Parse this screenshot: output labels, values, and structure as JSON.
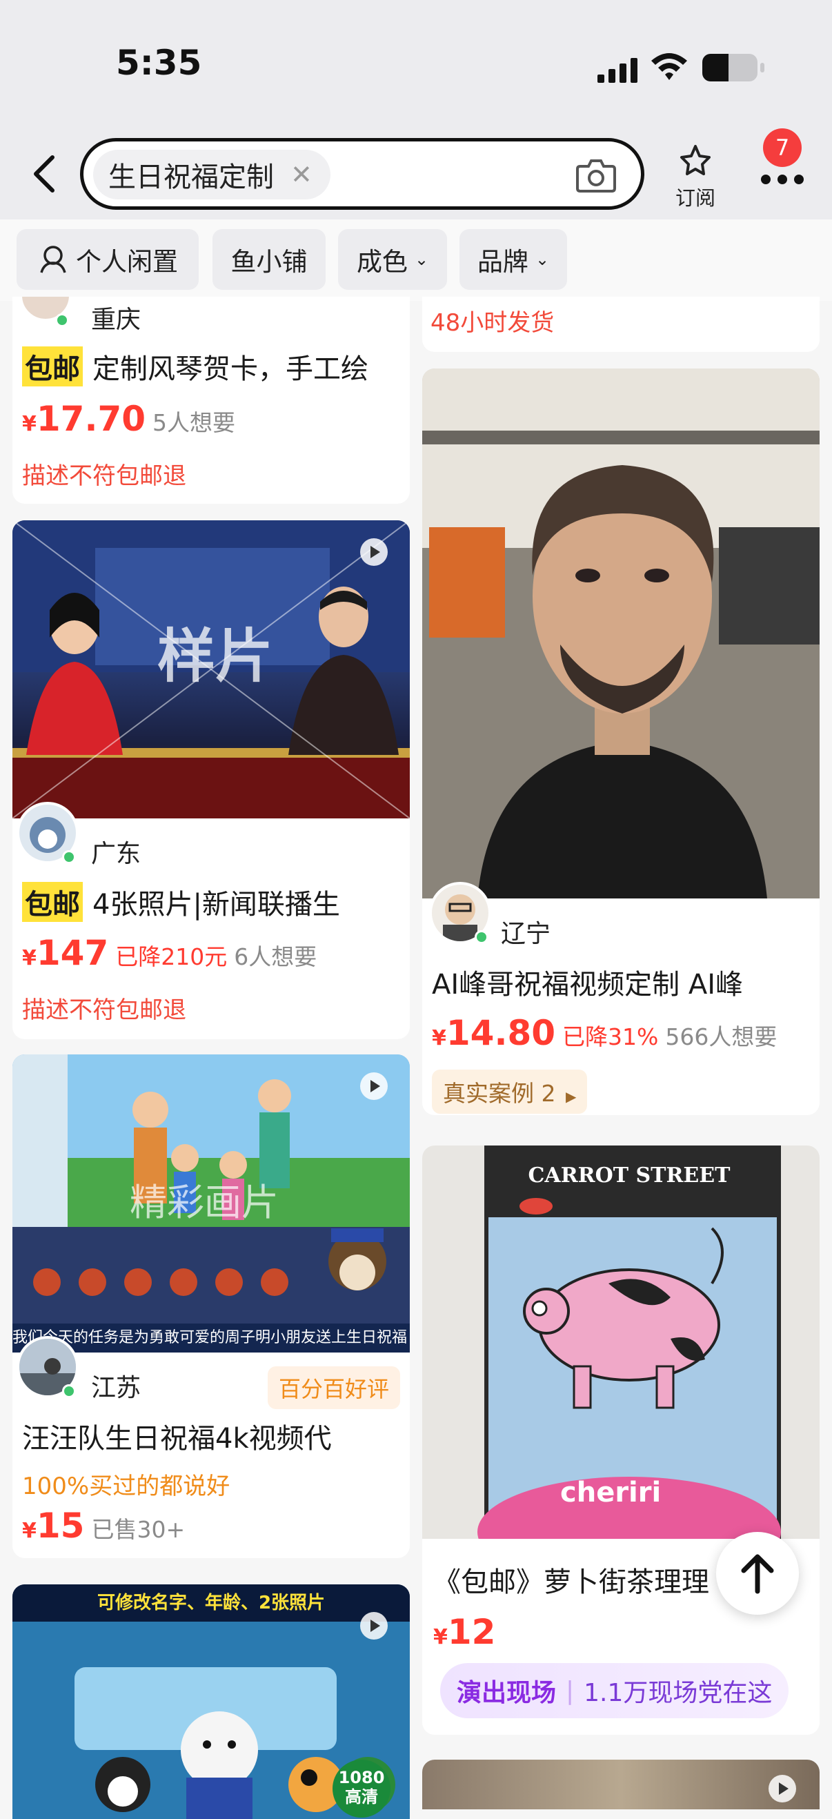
{
  "status_bar": {
    "time": "5:35"
  },
  "header": {
    "search_query": "生日祝福定制",
    "subscribe_label": "订阅",
    "notification_count": "7"
  },
  "filters": [
    "个人闲置",
    "鱼小铺",
    "成色",
    "品牌"
  ],
  "left_col": {
    "card1": {
      "location": "重庆",
      "tag": "包邮",
      "title": "定制风琴贺卡，手工绘",
      "price_symbol": "¥",
      "price": "17.70",
      "wants": "5人想要",
      "note": "描述不符包邮退"
    },
    "card2": {
      "location": "广东",
      "tag": "包邮",
      "title": "4张照片|新闻联播生",
      "price_symbol": "¥",
      "price": "147",
      "discount": "已降210元",
      "wants": "6人想要",
      "note": "描述不符包邮退",
      "image_text": "样片"
    },
    "card3": {
      "location": "江苏",
      "badge": "百分百好评",
      "title": "汪汪队生日祝福4k视频代",
      "praise": "100%买过的都说好",
      "price_symbol": "¥",
      "price": "15",
      "sold": "已售30+",
      "image_caption": "我们今天的任务是为勇敢可爱的周子明小朋友送上生日祝福",
      "image_watermark": "精彩画片"
    },
    "card4": {
      "image_banner": "可修改名字、年龄、2张照片",
      "hd_label_1": "1080",
      "hd_label_2": "高清"
    }
  },
  "right_col": {
    "top_note": "48小时发货",
    "card1": {
      "location": "辽宁",
      "title": "AI峰哥祝福视频定制 AI峰",
      "price_symbol": "¥",
      "price": "14.80",
      "discount": "已降31%",
      "wants": "566人想要",
      "example": "真实案例 2"
    },
    "card2": {
      "image_brand": "CARROT STREET",
      "image_logo": "cheriri",
      "title": "《包邮》萝卜街茶理理",
      "price_symbol": "¥",
      "price": "12",
      "live_label": "演出现场",
      "live_count": "1.1万现场党在这"
    }
  },
  "colors": {
    "accent_red": "#ff3b30",
    "promo_yellow": "#ffe23a",
    "orange": "#f08c1a",
    "purple": "#8a2be2",
    "online_green": "#3ec46d"
  }
}
